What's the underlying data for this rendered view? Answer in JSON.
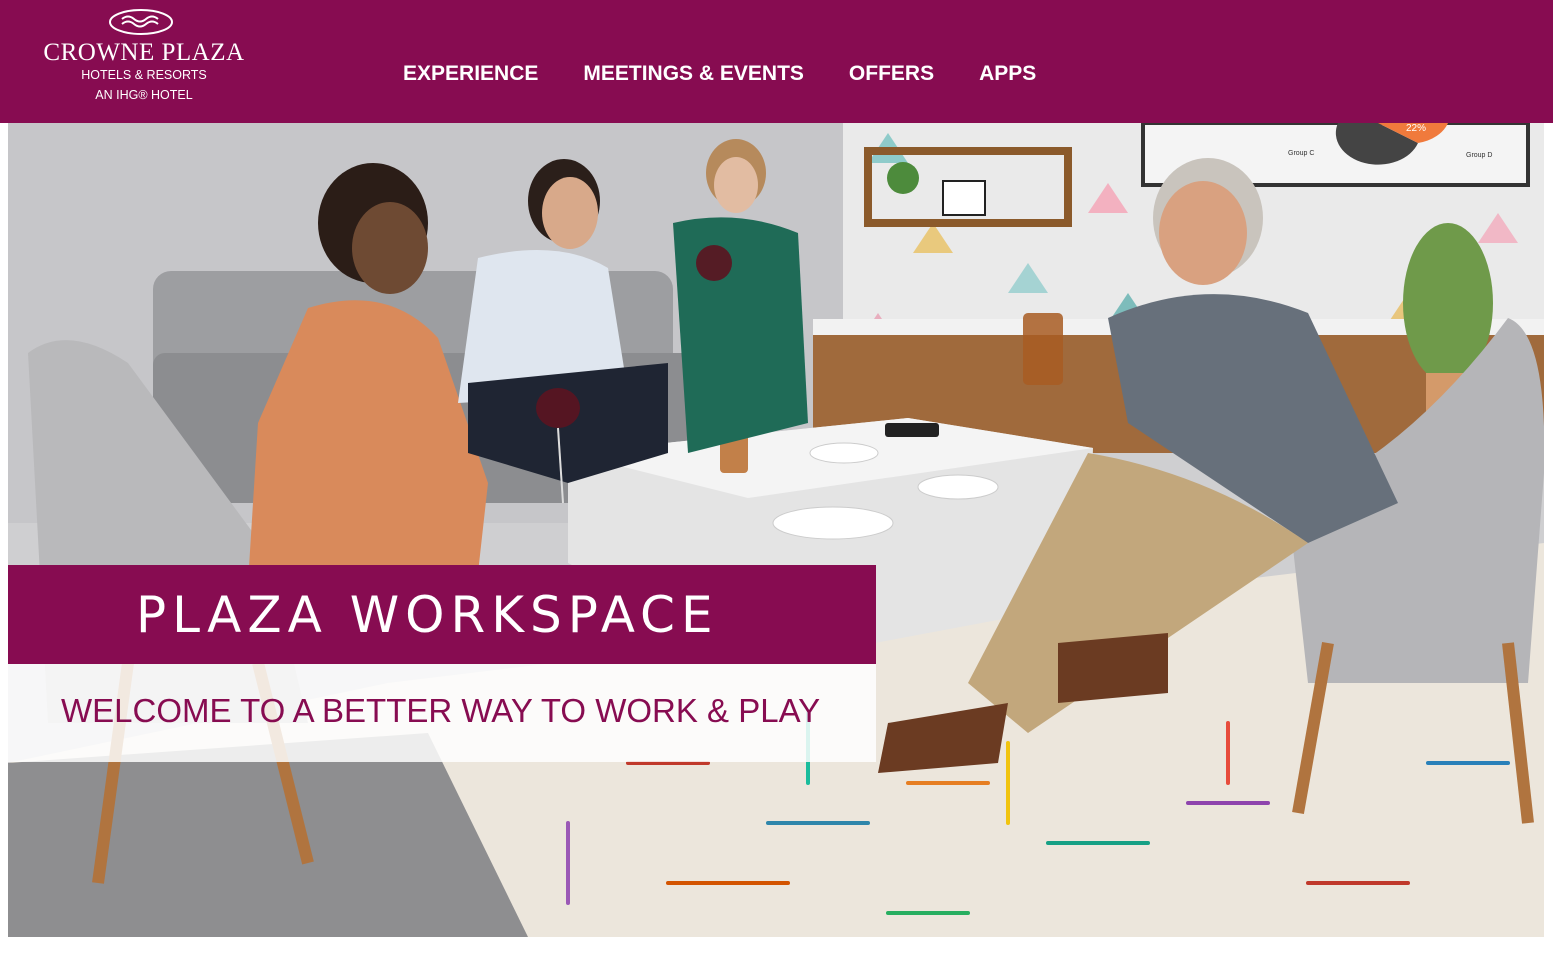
{
  "brand": {
    "name": "CROWNE PLAZA",
    "tagline": "HOTELS & RESORTS",
    "parent": "AN IHG® HOTEL"
  },
  "nav": {
    "items": [
      {
        "label": "EXPERIENCE"
      },
      {
        "label": "MEETINGS & EVENTS"
      },
      {
        "label": "OFFERS"
      },
      {
        "label": "APPS"
      }
    ]
  },
  "hero": {
    "title": "PLAZA WORKSPACE",
    "subtitle": "WELCOME TO A BETTER WAY TO WORK & PLAY",
    "screen_labels": {
      "percent": "22%",
      "group_c": "Group C",
      "group_d": "Group D"
    }
  },
  "colors": {
    "brand": "#870c51",
    "text_on_brand": "#ffffff"
  }
}
